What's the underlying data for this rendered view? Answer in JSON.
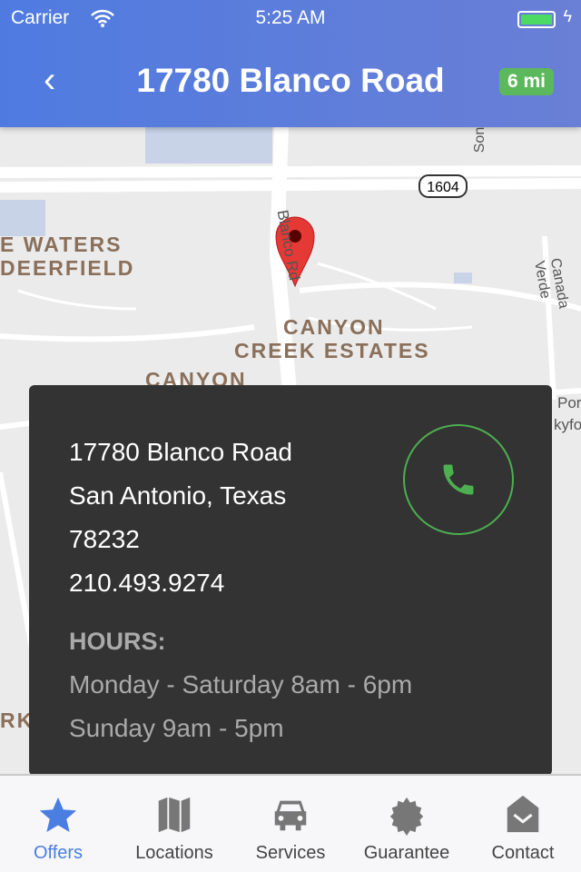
{
  "status": {
    "carrier": "Carrier",
    "time": "5:25 AM",
    "battery_level": 1.0
  },
  "header": {
    "title": "17780 Blanco Road",
    "distance_badge": "6 mi"
  },
  "map": {
    "labels": [
      "E WATERS",
      "DEERFIELD",
      "CANYON",
      "CREEK ESTATES",
      "CANYON",
      "Blanco Rd",
      "1604",
      "Canada Verde",
      "Son",
      "Por",
      "kyfo",
      "RK"
    ]
  },
  "card": {
    "address_line1": "17780 Blanco Road",
    "address_line2": "San Antonio, Texas",
    "zip": "78232",
    "phone": "210.493.9274",
    "hours_heading": "HOURS:",
    "hours": [
      "Monday - Saturday 8am - 6pm",
      "Sunday 9am - 5pm"
    ]
  },
  "tabs": [
    {
      "label": "Offers",
      "icon": "star-icon",
      "active": true
    },
    {
      "label": "Locations",
      "icon": "map-icon"
    },
    {
      "label": "Services",
      "icon": "car-icon"
    },
    {
      "label": "Guarantee",
      "icon": "badge-icon"
    },
    {
      "label": "Contact",
      "icon": "envelope-icon"
    }
  ],
  "colors": {
    "accent": "#4a7ee0",
    "badge": "#5cb85c",
    "phone": "#4caf50",
    "card": "#333333"
  }
}
